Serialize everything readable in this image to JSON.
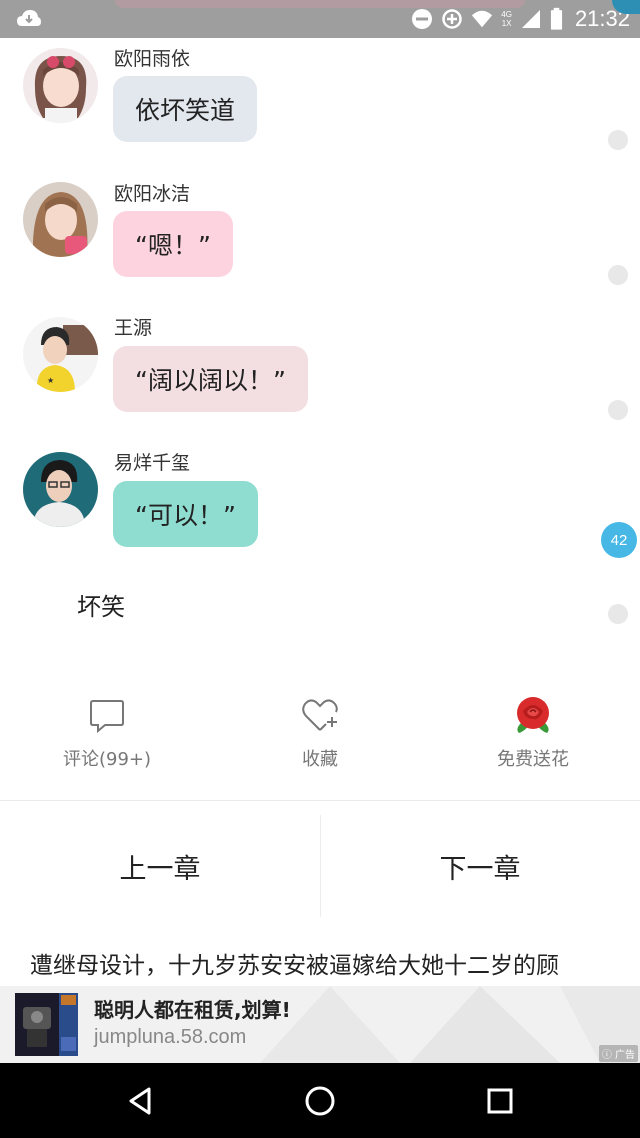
{
  "status_bar": {
    "time": "21:32",
    "network_top": "4G",
    "network_bottom": "1X"
  },
  "messages": [
    {
      "sender": "欧阳雨依",
      "text": "依坏笑道",
      "bubble_color": "#e3e8ef"
    },
    {
      "sender": "欧阳冰洁",
      "text": "“嗯！”",
      "bubble_color": "#fdd3e0"
    },
    {
      "sender": "王源",
      "text": "“阔以阔以！”",
      "bubble_color": "#f3dfe2"
    },
    {
      "sender": "易烊千玺",
      "text": "“可以！”",
      "bubble_color": "#8fdcd0"
    }
  ],
  "narration": "坏笑",
  "paragraph_badge": "42",
  "actions": [
    {
      "icon": "comment-icon",
      "label": "评论(99+)"
    },
    {
      "icon": "heart-add-icon",
      "label": "收藏"
    },
    {
      "icon": "rose-icon",
      "label": "免费送花"
    }
  ],
  "chapter_nav": {
    "prev": "上一章",
    "next": "下一章"
  },
  "synopsis": "遭继母设计，十九岁苏安安被逼嫁给大她十二岁的顾",
  "ad": {
    "title": "聪明人都在租赁,划算!",
    "url": "jumpluna.58.com",
    "tag": "广告"
  },
  "colors": {
    "accent_badge": "#47b8e6",
    "status_bar": "#9e9e9e"
  }
}
